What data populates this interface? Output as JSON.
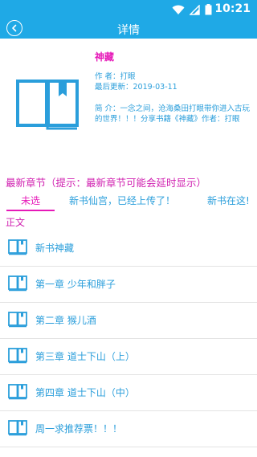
{
  "status_bar": {
    "time": "10:21",
    "icons": [
      "wifi-icon",
      "signal-icon",
      "battery-icon"
    ]
  },
  "app_bar": {
    "title": "详情",
    "back_icon": "back-icon"
  },
  "book": {
    "title": "神藏",
    "author_line": "作 者：打眼",
    "updated_line": "最后更新：2019-03-11",
    "description": "简 介：一念之间，沧海桑田打眼带你进入古玩的世界！！！分享书籍《神藏》作者：打眼"
  },
  "latest_chapter_label": "最新章节（提示：最新章节可能会延时显示）",
  "tabs": [
    {
      "label": "未选"
    },
    {
      "label": "新书仙宫，已经上传了！"
    },
    {
      "label": "新书在这!"
    }
  ],
  "section_label": "正文",
  "chapters": [
    {
      "name": "新书神藏"
    },
    {
      "name": "第一章 少年和胖子"
    },
    {
      "name": "第二章 猴儿酒"
    },
    {
      "name": "第三章 道士下山（上）"
    },
    {
      "name": "第四章 道士下山（中）"
    },
    {
      "name": "周一求推荐票！！！"
    }
  ],
  "colors": {
    "accent": "#1fa9e6",
    "magenta": "#e619b8",
    "link_blue": "#2a9edb"
  }
}
